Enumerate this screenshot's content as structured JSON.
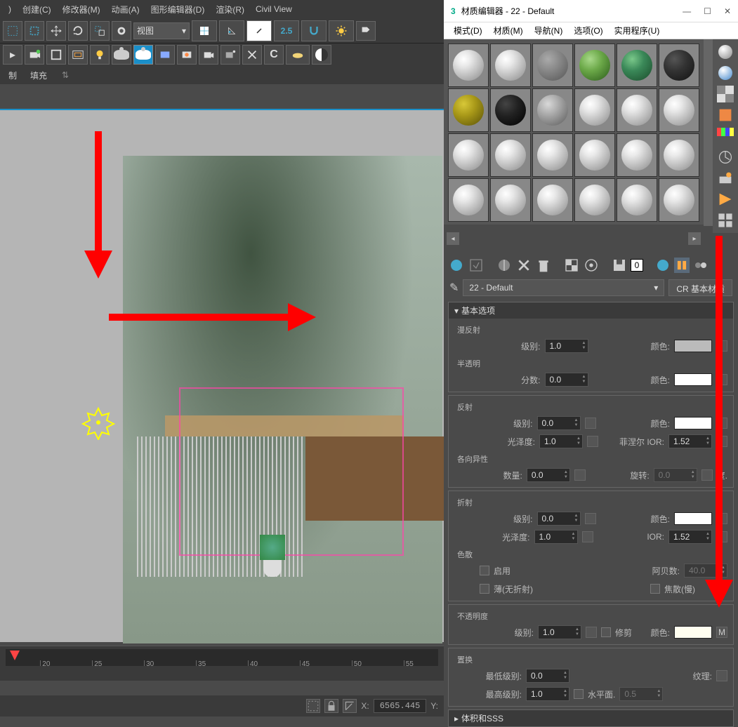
{
  "main_menu": {
    "create": "创建(C)",
    "modifier": "修改器(M)",
    "animation": "动画(A)",
    "graph": "图形编辑器(D)",
    "render": "渲染(R)",
    "civil": "Civil View"
  },
  "toolbar": {
    "view_dropdown": "视图",
    "scale_indicator": "2.5"
  },
  "secondary_bar": {
    "make": "制",
    "fill": "填充"
  },
  "status": {
    "x_label": "X:",
    "x_value": "6565.445",
    "y_label": "Y:"
  },
  "timeline": {
    "ticks": [
      "20",
      "25",
      "30",
      "35",
      "40",
      "45",
      "50",
      "55"
    ]
  },
  "material_editor": {
    "title": "材质编辑器 - 22 - Default",
    "menu": {
      "mode": "模式(D)",
      "material": "材质(M)",
      "nav": "导航(N)",
      "options": "选项(O)",
      "utilities": "实用程序(U)"
    },
    "slot_tools": {
      "digit": "0"
    },
    "current_name": "22 - Default",
    "type_button": "CR 基本材质",
    "sections": {
      "basic": {
        "header": "基本选项",
        "diffuse_label": "漫反射",
        "level": "级别:",
        "level_val": "1.0",
        "color": "颜色:",
        "translucency_label": "半透明",
        "fraction": "分数:",
        "fraction_val": "0.0"
      },
      "reflection": {
        "header": "反射",
        "level": "级别:",
        "level_val": "0.0",
        "color": "颜色:",
        "gloss": "光泽度:",
        "gloss_val": "1.0",
        "fresnel": "菲涅尔 IOR:",
        "fresnel_val": "1.52",
        "anisotropy_label": "各向异性",
        "amount": "数量:",
        "amount_val": "0.0",
        "rotation": "旋转:",
        "rotation_val": "0.0",
        "degree": "度."
      },
      "refraction": {
        "header": "折射",
        "level": "级别:",
        "level_val": "0.0",
        "color": "颜色:",
        "gloss": "光泽度:",
        "gloss_val": "1.0",
        "ior": "IOR:",
        "ior_val": "1.52",
        "dispersion_label": "色散",
        "enable": "启用",
        "abbe": "阿贝数:",
        "abbe_val": "40.0",
        "thin": "薄(无折射)",
        "caustics": "焦散(慢)"
      },
      "opacity": {
        "header": "不透明度",
        "level": "级别:",
        "level_val": "1.0",
        "clip": "修剪",
        "color": "颜色:",
        "map_m": "M"
      },
      "displacement": {
        "header": "置换",
        "min_level": "最低级别:",
        "min_val": "0.0",
        "texture": "纹理:",
        "max_level": "最高级别:",
        "max_val": "1.0",
        "water": "水平面.",
        "water_val": "0.5"
      },
      "sss": {
        "header": "体积和SSS"
      }
    },
    "slot_colors": [
      "",
      "",
      "gray",
      "green1",
      "green2",
      "dark",
      "yellow",
      "black",
      "noisy",
      "",
      "",
      "",
      "",
      "",
      "",
      "",
      "",
      "",
      "",
      "",
      "",
      "",
      "",
      ""
    ]
  }
}
